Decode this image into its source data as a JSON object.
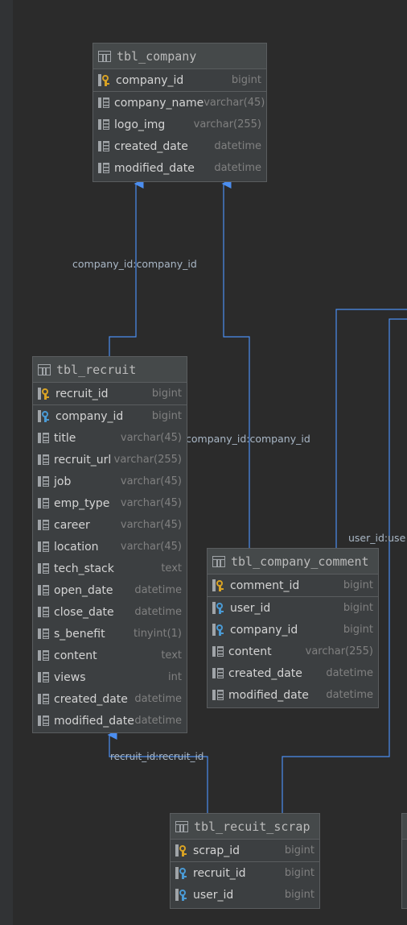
{
  "tables": [
    {
      "id": "tbl_company",
      "name": "tbl_company",
      "columns": [
        {
          "name": "company_id",
          "type": "bigint",
          "key": "pk",
          "divider": true
        },
        {
          "name": "company_name",
          "type": "varchar(45)",
          "key": ""
        },
        {
          "name": "logo_img",
          "type": "varchar(255)",
          "key": ""
        },
        {
          "name": "created_date",
          "type": "datetime",
          "key": ""
        },
        {
          "name": "modified_date",
          "type": "datetime",
          "key": ""
        }
      ]
    },
    {
      "id": "tbl_recruit",
      "name": "tbl_recruit",
      "columns": [
        {
          "name": "recruit_id",
          "type": "bigint",
          "key": "pk",
          "divider": true
        },
        {
          "name": "company_id",
          "type": "bigint",
          "key": "fk"
        },
        {
          "name": "title",
          "type": "varchar(45)",
          "key": ""
        },
        {
          "name": "recruit_url",
          "type": "varchar(255)",
          "key": ""
        },
        {
          "name": "job",
          "type": "varchar(45)",
          "key": ""
        },
        {
          "name": "emp_type",
          "type": "varchar(45)",
          "key": ""
        },
        {
          "name": "career",
          "type": "varchar(45)",
          "key": ""
        },
        {
          "name": "location",
          "type": "varchar(45)",
          "key": ""
        },
        {
          "name": "tech_stack",
          "type": "text",
          "key": ""
        },
        {
          "name": "open_date",
          "type": "datetime",
          "key": ""
        },
        {
          "name": "close_date",
          "type": "datetime",
          "key": ""
        },
        {
          "name": "s_benefit",
          "type": "tinyint(1)",
          "key": ""
        },
        {
          "name": "content",
          "type": "text",
          "key": ""
        },
        {
          "name": "views",
          "type": "int",
          "key": ""
        },
        {
          "name": "created_date",
          "type": "datetime",
          "key": ""
        },
        {
          "name": "modified_date",
          "type": "datetime",
          "key": ""
        }
      ]
    },
    {
      "id": "tbl_company_comment",
      "name": "tbl_company_comment",
      "columns": [
        {
          "name": "comment_id",
          "type": "bigint",
          "key": "pk",
          "divider": true
        },
        {
          "name": "user_id",
          "type": "bigint",
          "key": "fk"
        },
        {
          "name": "company_id",
          "type": "bigint",
          "key": "fk"
        },
        {
          "name": "content",
          "type": "varchar(255)",
          "key": ""
        },
        {
          "name": "created_date",
          "type": "datetime",
          "key": ""
        },
        {
          "name": "modified_date",
          "type": "datetime",
          "key": ""
        }
      ]
    },
    {
      "id": "tbl_recuit_scrap",
      "name": "tbl_recuit_scrap",
      "columns": [
        {
          "name": "scrap_id",
          "type": "bigint",
          "key": "pk",
          "divider": true
        },
        {
          "name": "recruit_id",
          "type": "bigint",
          "key": "fk"
        },
        {
          "name": "user_id",
          "type": "bigint",
          "key": "fk"
        }
      ]
    }
  ],
  "edge_labels": {
    "recruit_company": "company_id:company_id",
    "comment_company": "company_id:company_id",
    "comment_user": "user_id:use",
    "scrap_recruit": "recruit_id:recruit_id"
  },
  "colors": {
    "canvas": "#2b2b2b",
    "table_bg": "#3c3f41",
    "edge": "#4b8ef0",
    "pk_key": "#d8a224",
    "fk_key": "#4a9ad4"
  }
}
